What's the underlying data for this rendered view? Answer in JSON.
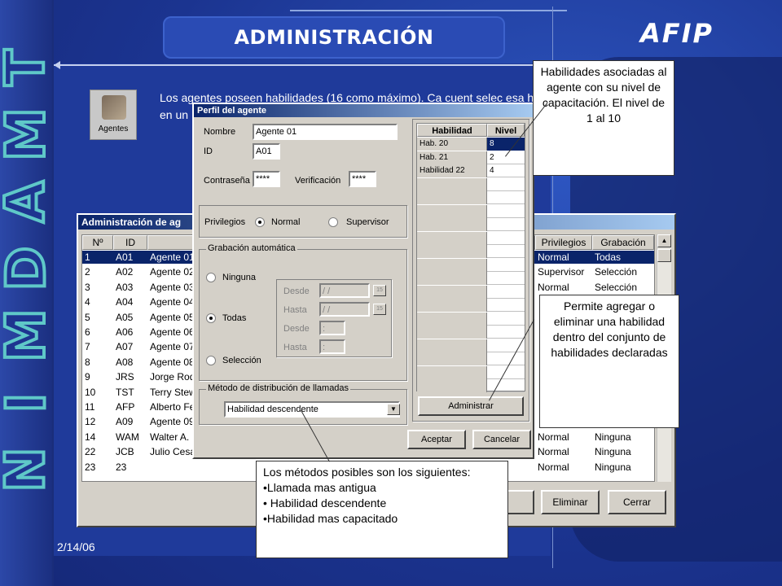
{
  "slide": {
    "title": "ADMINISTRACIÓN",
    "logo_text": "AFIP",
    "side_word": [
      "T",
      "M",
      "A",
      "D",
      "M",
      "I",
      "N"
    ],
    "date": "2/14/06",
    "intro_text": "Los agentes poseen habilidades (16 como máximo). Ca cuent selec esa h en un",
    "agents_icon_label": "Agentes"
  },
  "main_window": {
    "title": "Administración de ag",
    "columns": [
      "Nº",
      "ID",
      "",
      "Privilegios",
      "Grabación"
    ],
    "rows": [
      {
        "n": "1",
        "id": "A01",
        "name": "Agente 01",
        "priv": "Normal",
        "grab": "Todas"
      },
      {
        "n": "2",
        "id": "A02",
        "name": "Agente 02",
        "priv": "Supervisor",
        "grab": "Selección"
      },
      {
        "n": "3",
        "id": "A03",
        "name": "Agente 03",
        "priv": "Normal",
        "grab": "Selección"
      },
      {
        "n": "4",
        "id": "A04",
        "name": "Agente 04",
        "priv": "",
        "grab": ""
      },
      {
        "n": "5",
        "id": "A05",
        "name": "Agente 05",
        "priv": "",
        "grab": ""
      },
      {
        "n": "6",
        "id": "A06",
        "name": "Agente 06",
        "priv": "",
        "grab": ""
      },
      {
        "n": "7",
        "id": "A07",
        "name": "Agente 07",
        "priv": "",
        "grab": ""
      },
      {
        "n": "8",
        "id": "A08",
        "name": "Agente 08",
        "priv": "",
        "grab": ""
      },
      {
        "n": "9",
        "id": "JRS",
        "name": "Jorge Rod",
        "priv": "",
        "grab": ""
      },
      {
        "n": "10",
        "id": "TST",
        "name": "Terry Stew",
        "priv": "",
        "grab": ""
      },
      {
        "n": "11",
        "id": "AFP",
        "name": "Alberto Fe",
        "priv": "",
        "grab": ""
      },
      {
        "n": "12",
        "id": "A09",
        "name": "Agente 09",
        "priv": "",
        "grab": ""
      },
      {
        "n": "14",
        "id": "WAM",
        "name": "Walter A.",
        "priv": "Normal",
        "grab": "Ninguna"
      },
      {
        "n": "22",
        "id": "JCB",
        "name": "Julio Cesa",
        "priv": "Normal",
        "grab": "Ninguna"
      },
      {
        "n": "23",
        "id": "23",
        "name": "",
        "priv": "Normal",
        "grab": "Ninguna"
      }
    ],
    "buttons": {
      "eliminar": "Eliminar",
      "cerrar": "Cerrar"
    }
  },
  "profile_dialog": {
    "title": "Perfil del agente",
    "nombre_label": "Nombre",
    "nombre_value": "Agente 01",
    "id_label": "ID",
    "id_value": "A01",
    "password_label": "Contraseña",
    "password_value": "****",
    "verif_label": "Verificación",
    "verif_value": "****",
    "privilegios_label": "Privilegios",
    "priv_normal": "Normal",
    "priv_supervisor": "Supervisor",
    "grabacion_group": "Grabación automática",
    "grab_ninguna": "Ninguna",
    "grab_todas": "Todas",
    "grab_seleccion": "Selección",
    "desde_label": "Desde",
    "hasta_label": "Hasta",
    "date_value": "/ /",
    "time_value": ":",
    "metodo_group": "Método de distribución de llamadas",
    "metodo_value": "Habilidad descendente",
    "skills_columns": [
      "Habilidad",
      "Nivel"
    ],
    "skills": [
      {
        "name": "Hab. 20",
        "level": "8"
      },
      {
        "name": "Hab. 21",
        "level": "2"
      },
      {
        "name": "Habilidad 22",
        "level": "4"
      }
    ],
    "administrar_button": "Administrar",
    "aceptar_button": "Aceptar",
    "cancelar_button": "Cancelar"
  },
  "callouts": {
    "skills_note": "Habilidades asociadas al agente con su nivel de capacitación. El nivel de 1 al 10",
    "admin_note": "Permite agregar o eliminar una habilidad dentro del conjunto de habilidades declaradas",
    "methods_title": "Los métodos posibles son los siguientes:",
    "methods": [
      "•Llamada mas antigua",
      "• Habilidad descendente",
      "•Habilidad mas capacitado"
    ]
  },
  "colors": {
    "background": "#1b3490",
    "accent": "#5fc8c8",
    "selection": "#0a246a"
  }
}
